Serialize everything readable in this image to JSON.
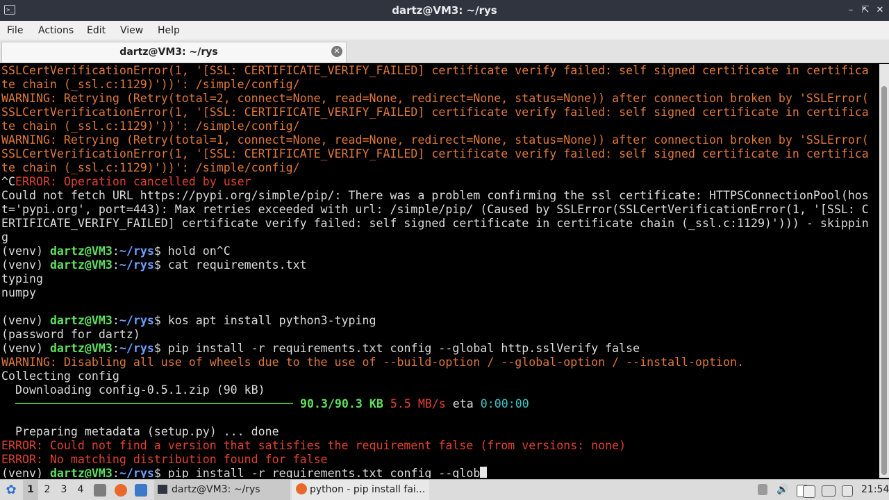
{
  "window": {
    "title": "dartz@VM3: ~/rys"
  },
  "menu": [
    "File",
    "Actions",
    "Edit",
    "View",
    "Help"
  ],
  "tab": {
    "label": "dartz@VM3: ~/rys"
  },
  "terminal": {
    "lines": [
      [
        {
          "t": "SSLCertVerificationError(1, '[SSL: CERTIFICATE_VERIFY_FAILED] certificate verify failed: self signed certificate in certifica",
          "c": "warn"
        }
      ],
      [
        {
          "t": "te chain (_ssl.c:1129)'))': /simple/config/",
          "c": "warn"
        }
      ],
      [
        {
          "t": "WARNING: Retrying (Retry(total=2, connect=None, read=None, redirect=None, status=None)) after connection broken by 'SSLError(",
          "c": "warn"
        }
      ],
      [
        {
          "t": "SSLCertVerificationError(1, '[SSL: CERTIFICATE_VERIFY_FAILED] certificate verify failed: self signed certificate in certifica",
          "c": "warn"
        }
      ],
      [
        {
          "t": "te chain (_ssl.c:1129)'))': /simple/config/",
          "c": "warn"
        }
      ],
      [
        {
          "t": "WARNING: Retrying (Retry(total=1, connect=None, read=None, redirect=None, status=None)) after connection broken by 'SSLError(",
          "c": "warn"
        }
      ],
      [
        {
          "t": "SSLCertVerificationError(1, '[SSL: CERTIFICATE_VERIFY_FAILED] certificate verify failed: self signed certificate in certifica",
          "c": "warn"
        }
      ],
      [
        {
          "t": "te chain (_ssl.c:1129)'))': /simple/config/",
          "c": "warn"
        }
      ],
      [
        {
          "t": "^C",
          "c": "white"
        },
        {
          "t": "ERROR: Operation cancelled by user",
          "c": "err"
        }
      ],
      [
        {
          "t": "Could not fetch URL https://pypi.org/simple/pip/: There was a problem confirming the ssl certificate: HTTPSConnectionPool(hos",
          "c": "white"
        }
      ],
      [
        {
          "t": "t='pypi.org', port=443): Max retries exceeded with url: /simple/pip/ (Caused by SSLError(SSLCertVerificationError(1, '[SSL: C",
          "c": "white"
        }
      ],
      [
        {
          "t": "ERTIFICATE_VERIFY_FAILED] certificate verify failed: self signed certificate in certificate chain (_ssl.c:1129)'))) - skippin",
          "c": "white"
        }
      ],
      [
        {
          "t": "g",
          "c": "white"
        }
      ],
      [
        {
          "t": "(venv) ",
          "c": "white"
        },
        {
          "t": "dartz@VM3",
          "c": "green"
        },
        {
          "t": ":",
          "c": "white"
        },
        {
          "t": "~/rys",
          "c": "blue"
        },
        {
          "t": "$ hold on^C",
          "c": "white"
        }
      ],
      [
        {
          "t": "(venv) ",
          "c": "white"
        },
        {
          "t": "dartz@VM3",
          "c": "green"
        },
        {
          "t": ":",
          "c": "white"
        },
        {
          "t": "~/rys",
          "c": "blue"
        },
        {
          "t": "$ cat requirements.txt",
          "c": "white"
        }
      ],
      [
        {
          "t": "typing",
          "c": "white"
        }
      ],
      [
        {
          "t": "numpy",
          "c": "white"
        }
      ],
      [],
      [
        {
          "t": "(venv) ",
          "c": "white"
        },
        {
          "t": "dartz@VM3",
          "c": "green"
        },
        {
          "t": ":",
          "c": "white"
        },
        {
          "t": "~/rys",
          "c": "blue"
        },
        {
          "t": "$ kos apt install python3-typing",
          "c": "white"
        }
      ],
      [
        {
          "t": "(password for dartz)",
          "c": "white"
        }
      ],
      [
        {
          "t": "(venv) ",
          "c": "white"
        },
        {
          "t": "dartz@VM3",
          "c": "green"
        },
        {
          "t": ":",
          "c": "white"
        },
        {
          "t": "~/rys",
          "c": "blue"
        },
        {
          "t": "$ pip install -r requirements.txt config --global http.sslVerify false",
          "c": "white"
        }
      ],
      [
        {
          "t": "WARNING: Disabling all use of wheels due to the use of --build-option / --global-option / --install-option.",
          "c": "warn"
        }
      ],
      [
        {
          "t": "Collecting config",
          "c": "white"
        }
      ],
      [
        {
          "t": "  Downloading config-0.5.1.zip (90 kB)",
          "c": "white"
        }
      ],
      [
        {
          "t": "  ",
          "c": "white"
        },
        {
          "bar": true
        },
        {
          "t": " ",
          "c": "white"
        },
        {
          "t": "90.3/90.3 KB",
          "c": "green"
        },
        {
          "t": " ",
          "c": "white"
        },
        {
          "t": "5.5 MB/s",
          "c": "red"
        },
        {
          "t": " eta ",
          "c": "white"
        },
        {
          "t": "0:00:00",
          "c": "cyan"
        }
      ],
      [],
      [
        {
          "t": "  Preparing metadata (setup.py) ... done",
          "c": "white"
        }
      ],
      [
        {
          "t": "ERROR: Could not find a version that satisfies the requirement false (from versions: none)",
          "c": "err"
        }
      ],
      [
        {
          "t": "ERROR: No matching distribution found for false",
          "c": "err"
        }
      ],
      [
        {
          "t": "(venv) ",
          "c": "white"
        },
        {
          "t": "dartz@VM3",
          "c": "green"
        },
        {
          "t": ":",
          "c": "white"
        },
        {
          "t": "~/rys",
          "c": "blue"
        },
        {
          "t": "$ pip install -r requirements.txt config --glob",
          "c": "white"
        },
        {
          "cursor": true
        }
      ]
    ]
  },
  "taskbar": {
    "workspaces": [
      "1",
      "2",
      "3",
      "4"
    ],
    "active_workspace": "1",
    "tasks": [
      "dartz@VM3: ~/rys",
      "python - pip install fai..."
    ],
    "clock": "21:54",
    "colors": {
      "warning": "#e0793a",
      "error": "#e0402e",
      "prompt_user": "#5fe05f",
      "prompt_path": "#6fa0ff"
    }
  }
}
